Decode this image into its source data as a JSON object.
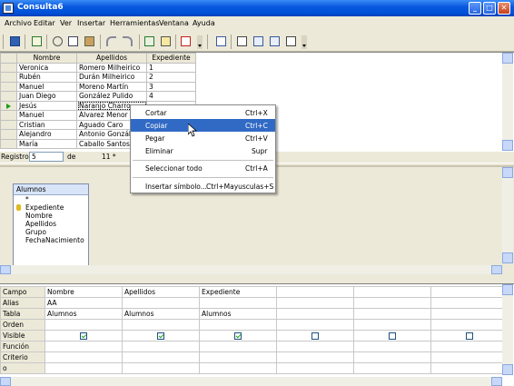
{
  "window": {
    "title": "Consulta6",
    "min": "_",
    "max": "□",
    "close": "✕"
  },
  "menu": [
    "Archivo",
    "Editar",
    "Ver",
    "Insertar",
    "Herramientas",
    "Ventana",
    "Ayuda"
  ],
  "grid": {
    "headers": [
      "Nombre",
      "Apellidos",
      "Expediente"
    ],
    "rows": [
      [
        "Veronica",
        "Romero Milheirico",
        "1"
      ],
      [
        "Rubén",
        "Durán Milheirico",
        "2"
      ],
      [
        "Manuel",
        "Moreno Martín",
        "3"
      ],
      [
        "Juan Diego",
        "González Pulido",
        "4"
      ],
      [
        "Jesús",
        "Naranjo Charro",
        ""
      ],
      [
        "Manuel",
        "Álvarez Menor",
        ""
      ],
      [
        "Cristian",
        "Aguado Caro",
        ""
      ],
      [
        "Alejandro",
        "Antonio González",
        ""
      ],
      [
        "María",
        "Caballo Santos",
        ""
      ]
    ],
    "record_label": "Registro",
    "record_value": "5",
    "of_label": "de",
    "total": "11 *"
  },
  "context_menu": {
    "items": [
      {
        "label": "Cortar",
        "shortcut": "Ctrl+X"
      },
      {
        "label": "Copiar",
        "shortcut": "Ctrl+C"
      },
      {
        "label": "Pegar",
        "shortcut": "Ctrl+V"
      },
      {
        "label": "Eliminar",
        "shortcut": "Supr"
      },
      {
        "label": "Seleccionar todo",
        "shortcut": "Ctrl+A"
      },
      {
        "label": "Insertar símbolo...",
        "shortcut": "Ctrl+Mayusculas+S"
      }
    ]
  },
  "relation": {
    "table_name": "Alumnos",
    "fields": [
      "*",
      "Expediente",
      "Nombre",
      "Apellidos",
      "Grupo",
      "FechaNacimiento"
    ]
  },
  "design": {
    "row_labels": [
      "Campo",
      "Alias",
      "Tabla",
      "Orden",
      "Visible",
      "Función",
      "Criterio",
      "o"
    ],
    "columns": [
      {
        "campo": "Nombre",
        "alias": "AA",
        "tabla": "Alumnos",
        "visible": true
      },
      {
        "campo": "Apellidos",
        "alias": "",
        "tabla": "Alumnos",
        "visible": true
      },
      {
        "campo": "Expediente",
        "alias": "",
        "tabla": "Alumnos",
        "visible": true
      },
      {
        "campo": "",
        "alias": "",
        "tabla": "",
        "visible": false
      },
      {
        "campo": "",
        "alias": "",
        "tabla": "",
        "visible": false
      },
      {
        "campo": "",
        "alias": "",
        "tabla": "",
        "visible": false
      }
    ]
  }
}
